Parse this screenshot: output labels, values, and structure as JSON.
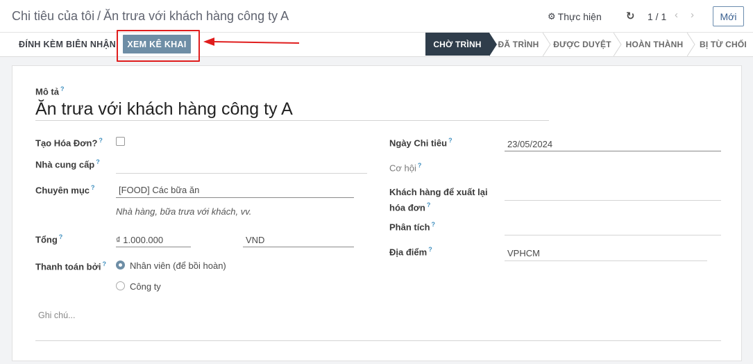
{
  "header": {
    "breadcrumb_parent": "Chi tiêu của tôi",
    "breadcrumb_sep": "/",
    "breadcrumb_current": "Ăn trưa với khách hàng công ty A",
    "action_label": "Thực hiện",
    "pager": "1 / 1",
    "new_label": "Mới"
  },
  "statusbar": {
    "attach_label": "ĐÍNH KÈM BIÊN NHẬN",
    "view_report_label": "XEM KÊ KHAI",
    "stages": [
      {
        "label": "CHỜ TRÌNH",
        "active": true
      },
      {
        "label": "ĐÃ TRÌNH",
        "active": false
      },
      {
        "label": "ĐƯỢC DUYỆT",
        "active": false
      },
      {
        "label": "HOÀN THÀNH",
        "active": false
      },
      {
        "label": "BỊ TỪ CHỐI",
        "active": false
      }
    ]
  },
  "form": {
    "description_label": "Mô tả",
    "description_value": "Ăn trưa với khách hàng công ty A",
    "create_invoice_label": "Tạo Hóa Đơn?",
    "create_invoice_checked": false,
    "vendor_label": "Nhà cung cấp",
    "category_label": "Chuyên mục",
    "category_value": "[FOOD] Các bữa ăn",
    "category_hint": "Nhà hàng, bữa trưa với khách, vv.",
    "total_label": "Tổng",
    "total_value": "₫ 1.000.000",
    "currency_value": "VND",
    "paid_by_label": "Thanh toán bởi",
    "paid_by_options": [
      {
        "label": "Nhân viên (để bồi hoàn)",
        "selected": true
      },
      {
        "label": "Công ty",
        "selected": false
      }
    ],
    "notes_placeholder": "Ghi chú...",
    "expense_date_label": "Ngày Chi tiêu",
    "expense_date_value": "23/05/2024",
    "opportunity_label": "Cơ hội",
    "customer_reinvoice_label": "Khách hàng để xuất lại hóa đơn",
    "analytic_label": "Phân tích",
    "location_label": "Địa điểm",
    "location_value": "VPHCM"
  },
  "help_marker": "?"
}
